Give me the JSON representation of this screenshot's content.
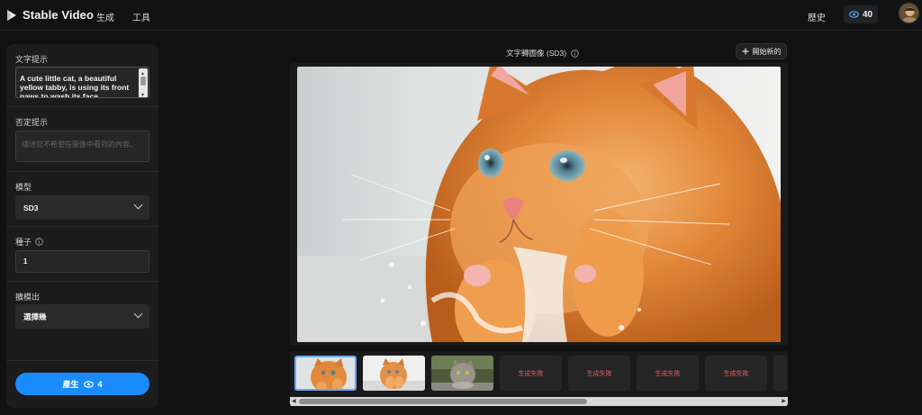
{
  "app": {
    "title": "Stable Video"
  },
  "nav": [
    {
      "label": "生成"
    },
    {
      "label": "工具"
    }
  ],
  "header": {
    "history_label": "歷史",
    "credits": "40"
  },
  "panel": {
    "prompt": {
      "label": "文字提示",
      "value": "A cute little cat, a beautiful yellow tabby, is using its front paws to wash its face."
    },
    "negative": {
      "label": "否定提示",
      "placeholder": "描述您不希望在圖像中看到的內容。"
    },
    "model": {
      "label": "模型",
      "value": "SD3"
    },
    "seed": {
      "label": "種子",
      "value": "1"
    },
    "output": {
      "label": "擴模出",
      "value": "選擇幾"
    },
    "generate": {
      "label": "產生",
      "cost": "4"
    }
  },
  "canvas": {
    "title": "文字轉圖像 (SD3)",
    "new_label": "開始新的"
  },
  "thumbnails": [
    {
      "kind": "image"
    },
    {
      "kind": "image"
    },
    {
      "kind": "image"
    },
    {
      "kind": "failed",
      "label": "生成失敗"
    },
    {
      "kind": "failed",
      "label": "生成失敗"
    },
    {
      "kind": "failed",
      "label": "生成失敗"
    },
    {
      "kind": "failed",
      "label": "生成失敗"
    }
  ],
  "icons": {
    "logo": "play-logo-icon",
    "credits": "eye-icon",
    "info": "info-icon",
    "new": "plus-icon",
    "dropdown": "chevron-down-icon"
  },
  "colors": {
    "accent": "#1a8cff",
    "fail_text": "#e05a5a",
    "background": "#111111",
    "panel": "#1c1c1c"
  }
}
